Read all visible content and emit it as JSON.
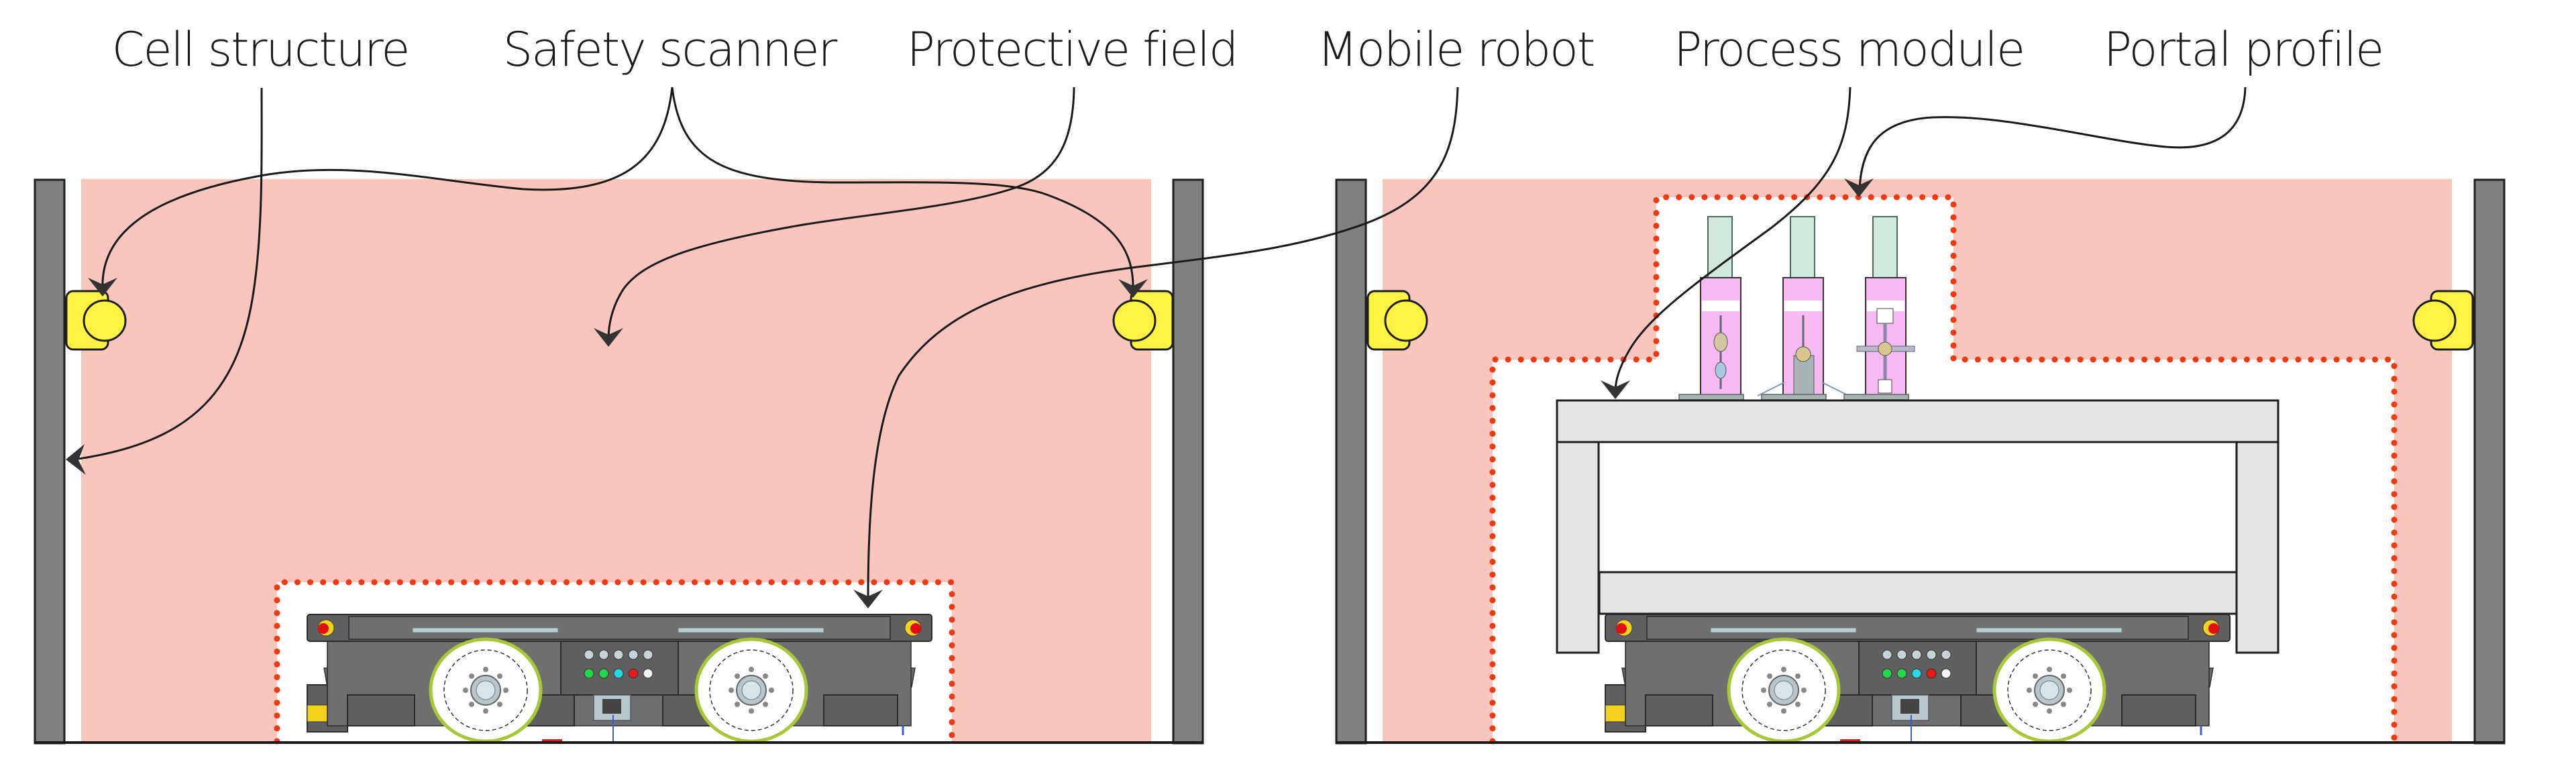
{
  "labels": {
    "cell_structure": "Cell structure",
    "safety_scanner": "Safety scanner",
    "protective_field": "Protective field",
    "mobile_robot": "Mobile robot",
    "process_module": "Process module",
    "portal_profile": "Portal profile"
  },
  "scenes": [
    {
      "id": "robot-only",
      "description": "Mobile robot alone inside cell with protective field"
    },
    {
      "id": "robot-with-portal",
      "description": "Mobile robot under portal profile carrying process module"
    }
  ],
  "colors": {
    "protective_field": "#f8c6bc",
    "field_boundary": "#ee3a14",
    "wall": "#808080",
    "scanner": "#fff345",
    "process_module": "#f7b9f3",
    "portal": "#e4e4e4"
  },
  "robot_panel": {
    "indicator_colors": [
      "#22d84a",
      "#22d84a",
      "#2ad6e6",
      "#e81818",
      "#f2f2f2"
    ]
  }
}
